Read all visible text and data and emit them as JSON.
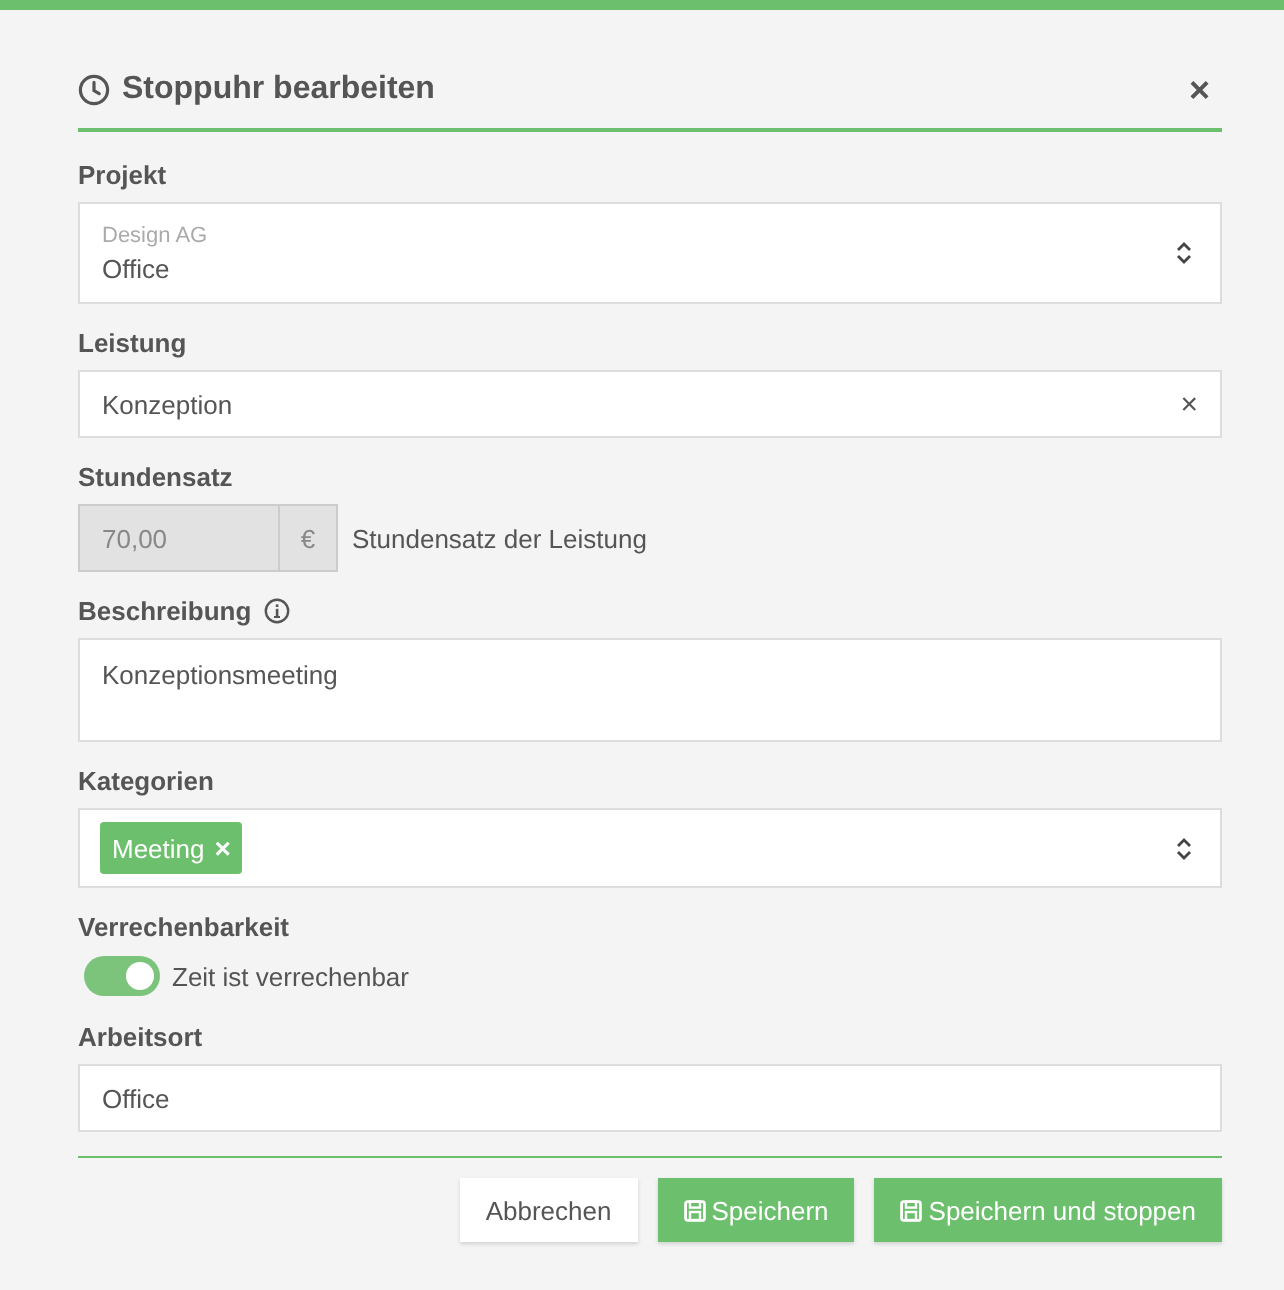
{
  "dialog": {
    "title": "Stoppuhr bearbeiten",
    "close": "×"
  },
  "fields": [
    {
      "kind": "select",
      "label": "Projekt",
      "group": "Design AG",
      "value": "Office"
    },
    {
      "kind": "clearable",
      "label": "Leistung",
      "value": "Konzeption",
      "clear": "×"
    },
    {
      "kind": "rate",
      "label": "Stundensatz",
      "value": "70,00",
      "unit": "€",
      "hint": "Stundensatz der Leistung",
      "disabled": true
    },
    {
      "kind": "textarea",
      "label": "Beschreibung",
      "info": true,
      "value": "Konzeptionsmeeting"
    },
    {
      "kind": "tags",
      "label": "Kategorien",
      "tags": [
        {
          "label": "Meeting",
          "remove": "×"
        }
      ]
    },
    {
      "kind": "toggle",
      "label": "Verrechenbarkeit",
      "on": true,
      "text": "Zeit ist verrechenbar"
    },
    {
      "kind": "text",
      "label": "Arbeitsort",
      "value": "Office"
    }
  ],
  "buttons": [
    {
      "label": "Abbrechen",
      "kind": "secondary"
    },
    {
      "label": "Speichern",
      "kind": "primary"
    },
    {
      "label": "Speichern und stoppen",
      "kind": "primary"
    }
  ]
}
